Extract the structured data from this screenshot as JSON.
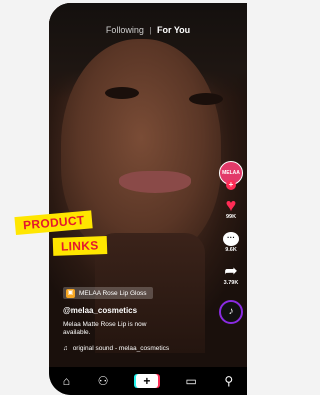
{
  "topnav": {
    "following": "Following",
    "separator": "|",
    "for_you": "For You"
  },
  "creator": {
    "avatar_text": "MELAA",
    "follow_plus": "+"
  },
  "actions": {
    "likes": "99K",
    "comments": "9.6K",
    "shares": "3.79K",
    "disc_icon": "♪"
  },
  "product": {
    "label": "MELAA Rose Lip Gloss",
    "icon": "bag-icon"
  },
  "post": {
    "handle": "@melaa_cosmetics",
    "caption": "Melaa Matte Rose Lip is now available.",
    "sound": "original sound - melaa_cosmetics"
  },
  "annotation": {
    "line1": "PRODUCT",
    "line2": "LINKS"
  },
  "colors": {
    "accent_red": "#fe2c55",
    "accent_cyan": "#25f4ee",
    "tag_yellow": "#ffe600",
    "tag_red": "#e4172e"
  },
  "bottom_nav": {
    "icons": [
      "home-icon",
      "friends-icon",
      "create-icon",
      "inbox-icon",
      "profile-icon"
    ]
  }
}
